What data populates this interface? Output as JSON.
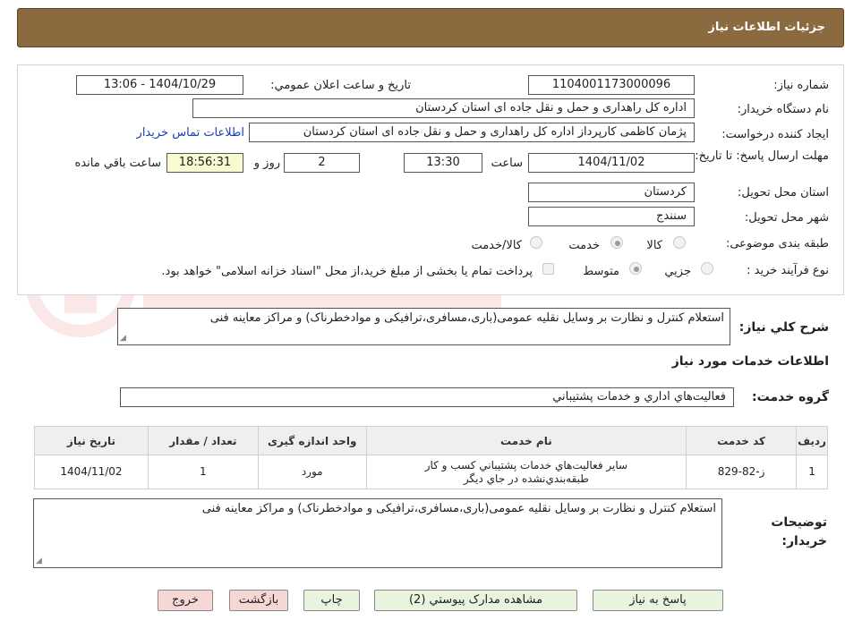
{
  "header": {
    "title": "جزئيات اطلاعات نياز"
  },
  "form": {
    "need_number_label": "شماره نياز:",
    "need_number": "1104001173000096",
    "announce_label": "تاريخ و ساعت اعلان عمومي:",
    "announce_value": "1404/10/29 - 13:06",
    "buyer_org_label": "نام دستگاه خريدار:",
    "buyer_org": "اداره کل راهداری و حمل و نقل جاده ای استان کردستان",
    "creator_label": "ايجاد کننده درخواست:",
    "creator": "پژمان کاظمی کارپرداز اداره کل راهداری و حمل و نقل جاده ای استان کردستان",
    "contact_link": "اطلاعات تماس خريدار",
    "deadline_label": "مهلت ارسال پاسخ: تا تاريخ:",
    "deadline_date": "1404/11/02",
    "time_word": "ساعت",
    "deadline_time": "13:30",
    "days_value": "2",
    "days_word": "روز و",
    "remaining_time": "18:56:31",
    "remaining_word": "ساعت باقي مانده",
    "province_label": "استان محل تحويل:",
    "province": "کردستان",
    "city_label": "شهر محل تحويل:",
    "city": "سنندج",
    "category_label": "طبقه بندی موضوعی:",
    "category_options": [
      "کالا",
      "خدمت",
      "کالا/خدمت"
    ],
    "purchase_type_label": "نوع فرآیند خرید :",
    "purchase_options": [
      "جزيي",
      "متوسط"
    ],
    "purchase_note": "پرداخت تمام يا بخشی از مبلغ خريد،از محل \"اسناد خزانه اسلامی\" خواهد بود."
  },
  "summary": {
    "label": "شرح کلي نياز:",
    "text": "استعلام کنترل و نظارت بر وسایل نقلیه عمومی(باری،مسافری،ترافیکی و موادخطرناک) و مراکز معاینه فنی"
  },
  "services": {
    "section_title": "اطلاعات خدمات مورد نياز",
    "group_label": "گروه خدمت:",
    "group_value": "فعاليت‌هاي اداري و خدمات پشتيباني",
    "columns": [
      "رديف",
      "کد خدمت",
      "نام خدمت",
      "واحد اندازه گيری",
      "تعداد / مقدار",
      "تاريخ نياز"
    ],
    "rows": [
      {
        "index": "1",
        "code": "ز-82-829",
        "name_line1": "ساير فعاليت‌هاي خدمات پشتيباني کسب و کار",
        "name_line2": "طبقه‌بندي‌نشده در جاي ديگر",
        "unit": "مورد",
        "quantity": "1",
        "date": "1404/11/02"
      }
    ]
  },
  "buyer_notes": {
    "label_line1": "توضيحات",
    "label_line2": "خريدار:",
    "text": "استعلام کنترل و نظارت بر وسایل نقلیه عمومی(باری،مسافری،ترافیکی و موادخطرناک) و مراکز معاینه فنی"
  },
  "buttons": {
    "reply": "پاسخ به نياز",
    "attachments": "مشاهده مدارک پيوستي (2)",
    "print": "چاپ",
    "back": "بازگشت",
    "exit": "خروج"
  },
  "colors": {
    "header_bg": "#8a6a3e",
    "link": "#1a3fb5",
    "timer_bg": "#fafad0"
  }
}
